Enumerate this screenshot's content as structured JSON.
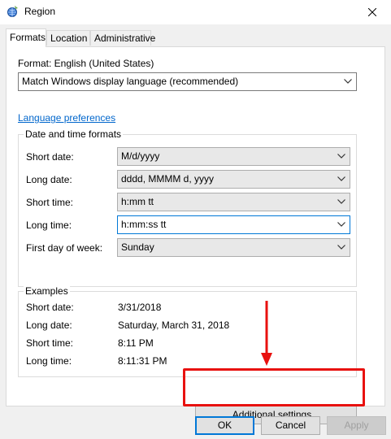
{
  "window": {
    "title": "Region",
    "close_symbol": "✕"
  },
  "tabs": [
    {
      "label": "Formats",
      "active": true
    },
    {
      "label": "Location",
      "active": false
    },
    {
      "label": "Administrative",
      "active": false
    }
  ],
  "format": {
    "label": "Format: English (United States)",
    "selected": "Match Windows display language (recommended)"
  },
  "language_link": "Language preferences",
  "date_time": {
    "group_title": "Date and time formats",
    "rows": [
      {
        "label": "Short date:",
        "value": "M/d/yyyy"
      },
      {
        "label": "Long date:",
        "value": "dddd, MMMM d, yyyy"
      },
      {
        "label": "Short time:",
        "value": "h:mm tt"
      },
      {
        "label": "Long time:",
        "value": "h:mm:ss tt"
      },
      {
        "label": "First day of week:",
        "value": "Sunday"
      }
    ]
  },
  "examples": {
    "group_title": "Examples",
    "rows": [
      {
        "label": "Short date:",
        "value": "3/31/2018"
      },
      {
        "label": "Long date:",
        "value": "Saturday, March 31, 2018"
      },
      {
        "label": "Short time:",
        "value": "8:11 PM"
      },
      {
        "label": "Long time:",
        "value": "8:11:31 PM"
      }
    ]
  },
  "buttons": {
    "additional": "Additional settings...",
    "ok": "OK",
    "cancel": "Cancel",
    "apply": "Apply"
  },
  "colors": {
    "accent": "#0078d7",
    "annotation": "#e8110f",
    "link": "#0066cc"
  }
}
